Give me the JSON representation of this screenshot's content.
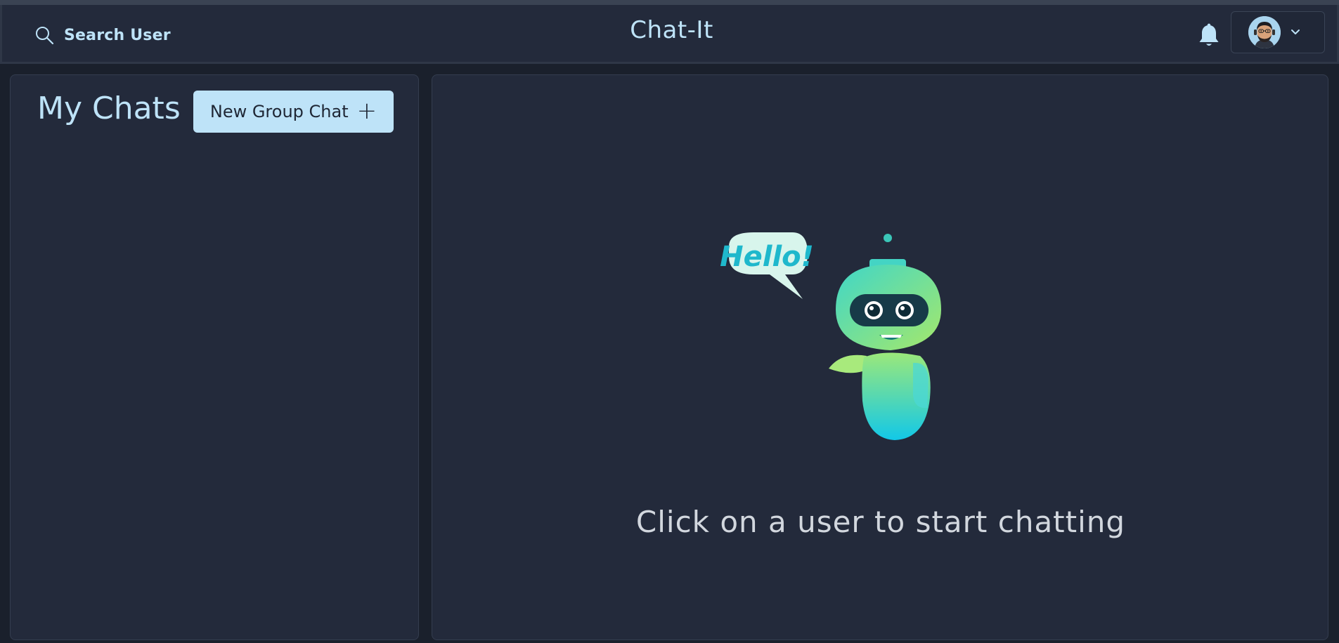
{
  "header": {
    "search_label": "Search User",
    "app_title": "Chat-It",
    "icons": {
      "search": "search-icon",
      "bell": "bell-icon",
      "chevron": "chevron-down-icon"
    }
  },
  "sidebar": {
    "title": "My Chats",
    "new_group_label": "New Group Chat",
    "new_group_icon": "+"
  },
  "chat_panel": {
    "illustration_text": "Hello!",
    "empty_message": "Click on a user to start chatting"
  },
  "colors": {
    "background": "#1a202c",
    "panel": "#232a3b",
    "accent": "#bee3f8",
    "robot_teal": "#2dd4d4"
  }
}
